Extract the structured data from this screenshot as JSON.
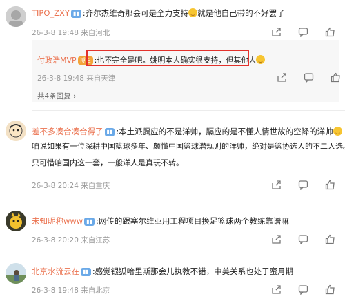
{
  "comments": [
    {
      "username": "TIPO_ZXY",
      "text": ":齐尔杰维奇那会可是全力支持",
      "text_after": "就是他自己带的不好罢了",
      "time": "26-3-8 19:48",
      "location": "来自河北",
      "replies": [
        {
          "username": "付政浩MVP",
          "badge": "博主",
          "text": ":也不完全是吧。姚明本人确实很支持，但其他人",
          "time": "26-3-8 19:48",
          "location": "来自天津"
        }
      ],
      "reply_count": "共4条回复"
    },
    {
      "username": "差不多凑合凑合得了",
      "lines": [
        ":本土派膈应的不是洋帅，膈应的是不懂人情世故的空降的洋帅",
        "咱说如果有一位深耕中国篮球多年、颇懂中国篮球潜规则的洋帅，绝对是篮协选人的不二人选。",
        "只可惜咱国内这一套，一般洋人是真玩不转。"
      ],
      "time": "26-3-8 20:24",
      "location": "来自重庆"
    },
    {
      "username": "未知昵称www",
      "text": ":网传的跟塞尔维亚用工程项目换足篮球两个教练靠谱嘛",
      "time": "26-3-8 20:20",
      "location": "来自江苏"
    },
    {
      "username": "北京水流云在",
      "text": ":感觉银狐哈里斯那会儿执教不错，中美关系也处于蜜月期",
      "time": "26-3-8 19:48",
      "location": "来自北京"
    }
  ],
  "icons": [
    "share-icon",
    "comment-icon",
    "like-icon"
  ],
  "colors": {
    "username": "#eb7350",
    "highlight": "#e3322c",
    "meta": "#999999"
  }
}
